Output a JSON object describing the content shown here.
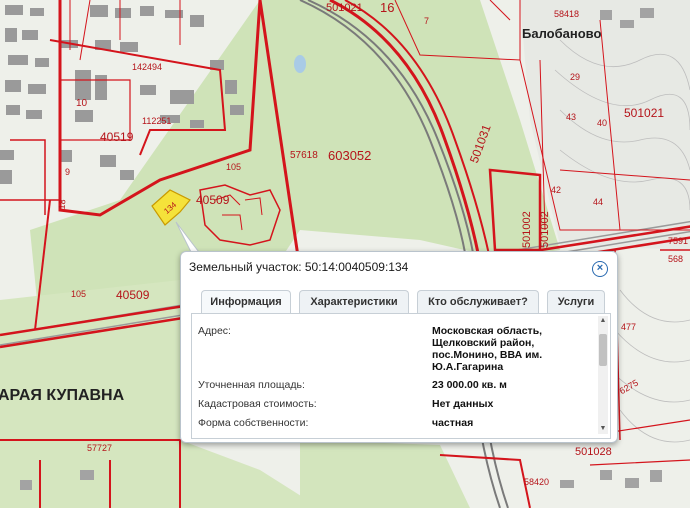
{
  "map": {
    "place_labels": [
      "Балобаново",
      "АРАЯ КУПАВНА"
    ],
    "parcel_labels": [
      "501021",
      "16",
      "7",
      "58418",
      "29",
      "142494",
      "10",
      "112251",
      "40519",
      "501021",
      "43",
      "40",
      "57618",
      "603052",
      "501031",
      "105",
      "40509",
      "134",
      "9",
      "18",
      "501002",
      "501002",
      "42",
      "44",
      "7591",
      "568",
      "105",
      "40509",
      "477",
      "57727",
      "58420",
      "501028",
      "6275"
    ],
    "selected_parcel_label": "134"
  },
  "popup": {
    "title": "Земельный участок: 50:14:0040509:134",
    "close_symbol": "×",
    "tabs": [
      "Информация",
      "Характеристики",
      "Кто обслуживает?",
      "Услуги"
    ],
    "active_tab": "Информация",
    "fields": [
      {
        "label": "Адрес:",
        "value": "Московская область,\nЩелковский район,\nпос.Монино, ВВА им.\nЮ.А.Гагарина"
      },
      {
        "label": "Уточненная площадь:",
        "value": "23 000.00 кв. м"
      },
      {
        "label": "Кадастровая стоимость:",
        "value": "Нет данных"
      },
      {
        "label": "Форма собственности:",
        "value": "частная"
      }
    ]
  },
  "colors": {
    "boundary": "#d4141c",
    "selected_fill": "#f5e23a",
    "forest": "#cfe3b8",
    "buildings": "#8a8a8a",
    "tab_accent": "#2a6ab0"
  }
}
